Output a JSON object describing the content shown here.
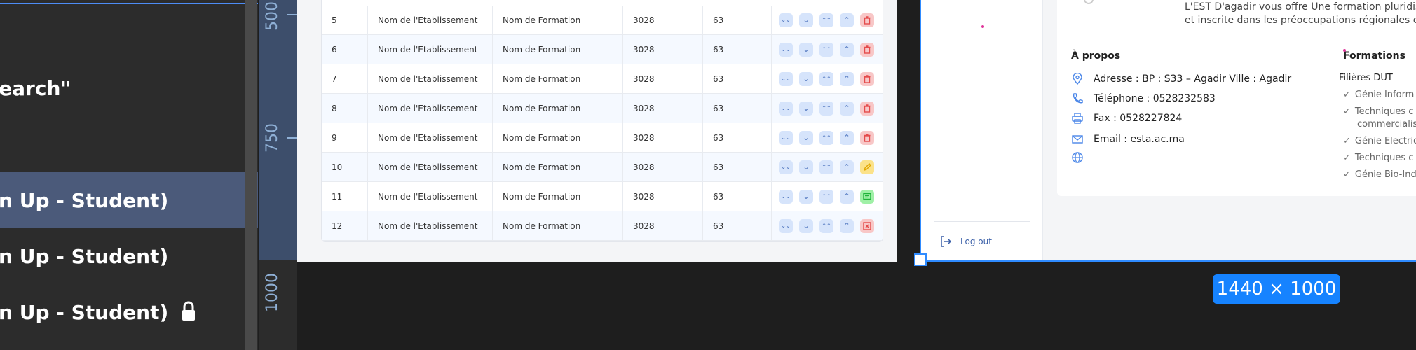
{
  "layers": {
    "items": [
      {
        "label": "Search\"",
        "selected": false,
        "locked": false
      },
      {
        "label": "gn Up - Student)",
        "selected": true,
        "locked": false
      },
      {
        "label": "gn Up - Student)",
        "selected": false,
        "locked": false
      },
      {
        "label": "gn Up - Student)",
        "selected": false,
        "locked": true
      }
    ]
  },
  "ruler": {
    "labels": [
      "500",
      "750",
      "1000"
    ]
  },
  "table": {
    "rows": [
      {
        "id": "5",
        "etab": "Nom de l'Etablissement",
        "formation": "Nom de Formation",
        "code": "3028",
        "num": "63",
        "last_action": "delete"
      },
      {
        "id": "6",
        "etab": "Nom de l'Etablissement",
        "formation": "Nom de Formation",
        "code": "3028",
        "num": "63",
        "last_action": "delete"
      },
      {
        "id": "7",
        "etab": "Nom de l'Etablissement",
        "formation": "Nom de Formation",
        "code": "3028",
        "num": "63",
        "last_action": "delete"
      },
      {
        "id": "8",
        "etab": "Nom de l'Etablissement",
        "formation": "Nom de Formation",
        "code": "3028",
        "num": "63",
        "last_action": "delete"
      },
      {
        "id": "9",
        "etab": "Nom de l'Etablissement",
        "formation": "Nom de Formation",
        "code": "3028",
        "num": "63",
        "last_action": "delete"
      },
      {
        "id": "10",
        "etab": "Nom de l'Etablissement",
        "formation": "Nom de Formation",
        "code": "3028",
        "num": "63",
        "last_action": "edit"
      },
      {
        "id": "11",
        "etab": "Nom de l'Etablissement",
        "formation": "Nom de Formation",
        "code": "3028",
        "num": "63",
        "last_action": "message"
      },
      {
        "id": "12",
        "etab": "Nom de l'Etablissement",
        "formation": "Nom de Formation",
        "code": "3028",
        "num": "63",
        "last_action": "close"
      }
    ],
    "colors": {
      "action": "#d6e4fb",
      "delete": "#f8c7c7",
      "edit": "#fbe28a",
      "message": "#9ff0a6"
    }
  },
  "profile": {
    "description": [
      "L'EST D'agadir vous offre Une formation pluridiscip",
      "et inscrite dans les préoccupations régionales et"
    ],
    "about_title": "À propos",
    "address": "Adresse : BP : S33 – Agadir Ville : Agadir",
    "phone": "Téléphone : 0528232583",
    "fax": "Fax : 0528227824",
    "email": "Email : esta.ac.ma",
    "formations_title": "Formations",
    "filieres_title": "Filières DUT",
    "filieres": [
      "Génie Inform",
      "Techniques c",
      "commercialis",
      "Génie Electric",
      "Techniques c",
      "Génie Bio-Ind"
    ],
    "logout": "Log out"
  },
  "frame_size": "1440 × 1000",
  "accent": "#2f8bff"
}
